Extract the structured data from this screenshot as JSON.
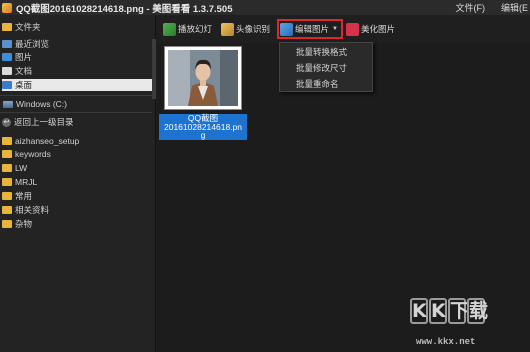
{
  "window": {
    "title": "QQ截图20161028214618.png - 美图看看 1.3.7.505",
    "menu": [
      "文件(F)",
      "编辑(E"
    ]
  },
  "sidebar": {
    "items": [
      {
        "label": "文件夹",
        "icon": "folder-icon"
      },
      {
        "label": "最近浏览",
        "icon": "recent-icon"
      },
      {
        "label": "图片",
        "icon": "picture-icon"
      },
      {
        "label": "文档",
        "icon": "document-icon"
      },
      {
        "label": "桌面",
        "icon": "desktop-icon",
        "selected": true
      }
    ],
    "drive": "Windows (C:)",
    "back_label": "返回上一级目录",
    "folders": [
      "aizhanseo_setup",
      "keywords",
      "LW",
      "MRJL",
      "常用",
      "相关资料",
      "杂物"
    ]
  },
  "toolbar": {
    "slideshow": "播放幻灯",
    "face_recognition": "头像识别",
    "edit_picture": "编辑图片",
    "beautify": "美化图片",
    "colors": {
      "highlight": "#e0262c"
    }
  },
  "dropdown": {
    "items": [
      "批量转换格式",
      "批量修改尺寸",
      "批量重命名"
    ]
  },
  "content": {
    "thumbnail_caption": "QQ截图20161028214618.png",
    "caption_lines": [
      "QQ截图",
      "20161028214618.pn",
      "g"
    ]
  },
  "watermark": {
    "logo": [
      "K",
      "K",
      "下",
      "载"
    ],
    "url": "www.kkx.net"
  }
}
